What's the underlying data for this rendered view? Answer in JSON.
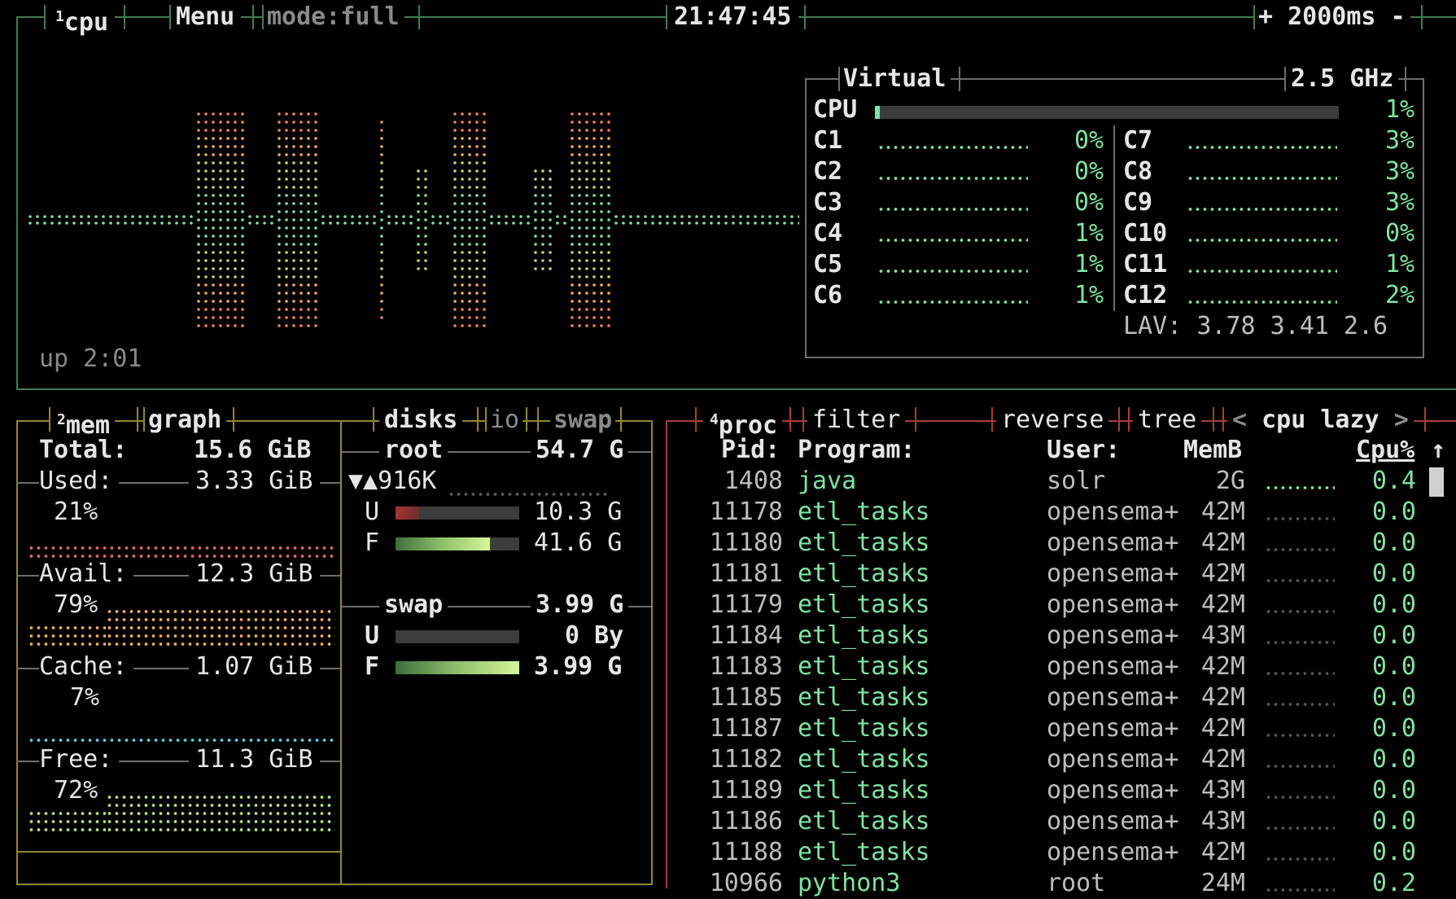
{
  "colors": {
    "cpu_border": "#3f7d52",
    "mem_border": "#8e8a34",
    "proc_border": "#a83c3c",
    "graph_green": "#7fe3a2",
    "graph_orange": "#f08a4b"
  },
  "cpu_box": {
    "index": "1",
    "title": "cpu",
    "menu": "Menu",
    "mode": "mode:full",
    "clock": "21:47:45",
    "interval_plus": "+",
    "interval": "2000ms",
    "interval_minus": "-",
    "uptime": "up 2:01",
    "cpu_name": "Virtual",
    "freq": "2.5 GHz",
    "total_label": "CPU",
    "total_pct": "1%",
    "total_fill": 0.01,
    "cores_left": [
      {
        "name": "C1",
        "pct": "0%"
      },
      {
        "name": "C2",
        "pct": "0%"
      },
      {
        "name": "C3",
        "pct": "0%"
      },
      {
        "name": "C4",
        "pct": "1%"
      },
      {
        "name": "C5",
        "pct": "1%"
      },
      {
        "name": "C6",
        "pct": "1%"
      }
    ],
    "cores_right": [
      {
        "name": "C7",
        "pct": "3%"
      },
      {
        "name": "C8",
        "pct": "3%"
      },
      {
        "name": "C9",
        "pct": "3%"
      },
      {
        "name": "C10",
        "pct": "0%"
      },
      {
        "name": "C11",
        "pct": "1%"
      },
      {
        "name": "C12",
        "pct": "2%"
      }
    ],
    "lav_label": "LAV:",
    "lav": "3.78 3.41 2.6"
  },
  "mem_box": {
    "index": "2",
    "title": "mem",
    "graph": "graph",
    "total_label": "Total:",
    "total": "15.6 GiB",
    "used_label": "Used:",
    "used": "3.33 GiB",
    "used_pct": "21%",
    "avail_label": "Avail:",
    "avail": "12.3 GiB",
    "avail_pct": "79%",
    "cache_label": "Cache:",
    "cache": "1.07 GiB",
    "cache_pct": "7%",
    "free_label": "Free:",
    "free": "11.3 GiB",
    "free_pct": "72%"
  },
  "disks_box": {
    "title": "disks",
    "io": "io",
    "swap_tab": "swap",
    "root_label": "root",
    "root_size": "54.7 G",
    "io_text": "▼▲916K",
    "u_label": "U",
    "u_val": "10.3 G",
    "u_fill": 0.19,
    "f_label": "F",
    "f_val": "41.6 G",
    "f_fill": 0.76,
    "swap_label": "swap",
    "swap_size": "3.99 G",
    "su_label": "U",
    "su_val": "0 By",
    "su_fill": 0.0,
    "sf_label": "F",
    "sf_val": "3.99 G",
    "sf_fill": 1.0
  },
  "proc_box": {
    "index": "4",
    "title": "proc",
    "filter": "filter",
    "reverse": "reverse",
    "tree": "tree",
    "sort_prev": "<",
    "sort": "cpu lazy",
    "sort_next": ">",
    "col_pid": "Pid:",
    "col_program": "Program:",
    "col_user": "User:",
    "col_mem": "MemB",
    "col_cpu": "Cpu%",
    "sort_arrow": "↑",
    "rows": [
      {
        "pid": "1408",
        "program": "java",
        "user": "solr",
        "mem": "2G",
        "cpu": "0.4"
      },
      {
        "pid": "11178",
        "program": "etl_tasks",
        "user": "opensema+",
        "mem": "42M",
        "cpu": "0.0"
      },
      {
        "pid": "11180",
        "program": "etl_tasks",
        "user": "opensema+",
        "mem": "42M",
        "cpu": "0.0"
      },
      {
        "pid": "11181",
        "program": "etl_tasks",
        "user": "opensema+",
        "mem": "42M",
        "cpu": "0.0"
      },
      {
        "pid": "11179",
        "program": "etl_tasks",
        "user": "opensema+",
        "mem": "42M",
        "cpu": "0.0"
      },
      {
        "pid": "11184",
        "program": "etl_tasks",
        "user": "opensema+",
        "mem": "43M",
        "cpu": "0.0"
      },
      {
        "pid": "11183",
        "program": "etl_tasks",
        "user": "opensema+",
        "mem": "42M",
        "cpu": "0.0"
      },
      {
        "pid": "11185",
        "program": "etl_tasks",
        "user": "opensema+",
        "mem": "42M",
        "cpu": "0.0"
      },
      {
        "pid": "11187",
        "program": "etl_tasks",
        "user": "opensema+",
        "mem": "42M",
        "cpu": "0.0"
      },
      {
        "pid": "11182",
        "program": "etl_tasks",
        "user": "opensema+",
        "mem": "42M",
        "cpu": "0.0"
      },
      {
        "pid": "11189",
        "program": "etl_tasks",
        "user": "opensema+",
        "mem": "43M",
        "cpu": "0.0"
      },
      {
        "pid": "11186",
        "program": "etl_tasks",
        "user": "opensema+",
        "mem": "43M",
        "cpu": "0.0"
      },
      {
        "pid": "11188",
        "program": "etl_tasks",
        "user": "opensema+",
        "mem": "42M",
        "cpu": "0.0"
      },
      {
        "pid": "10966",
        "program": "python3",
        "user": "root",
        "mem": "24M",
        "cpu": "0.2"
      }
    ]
  }
}
